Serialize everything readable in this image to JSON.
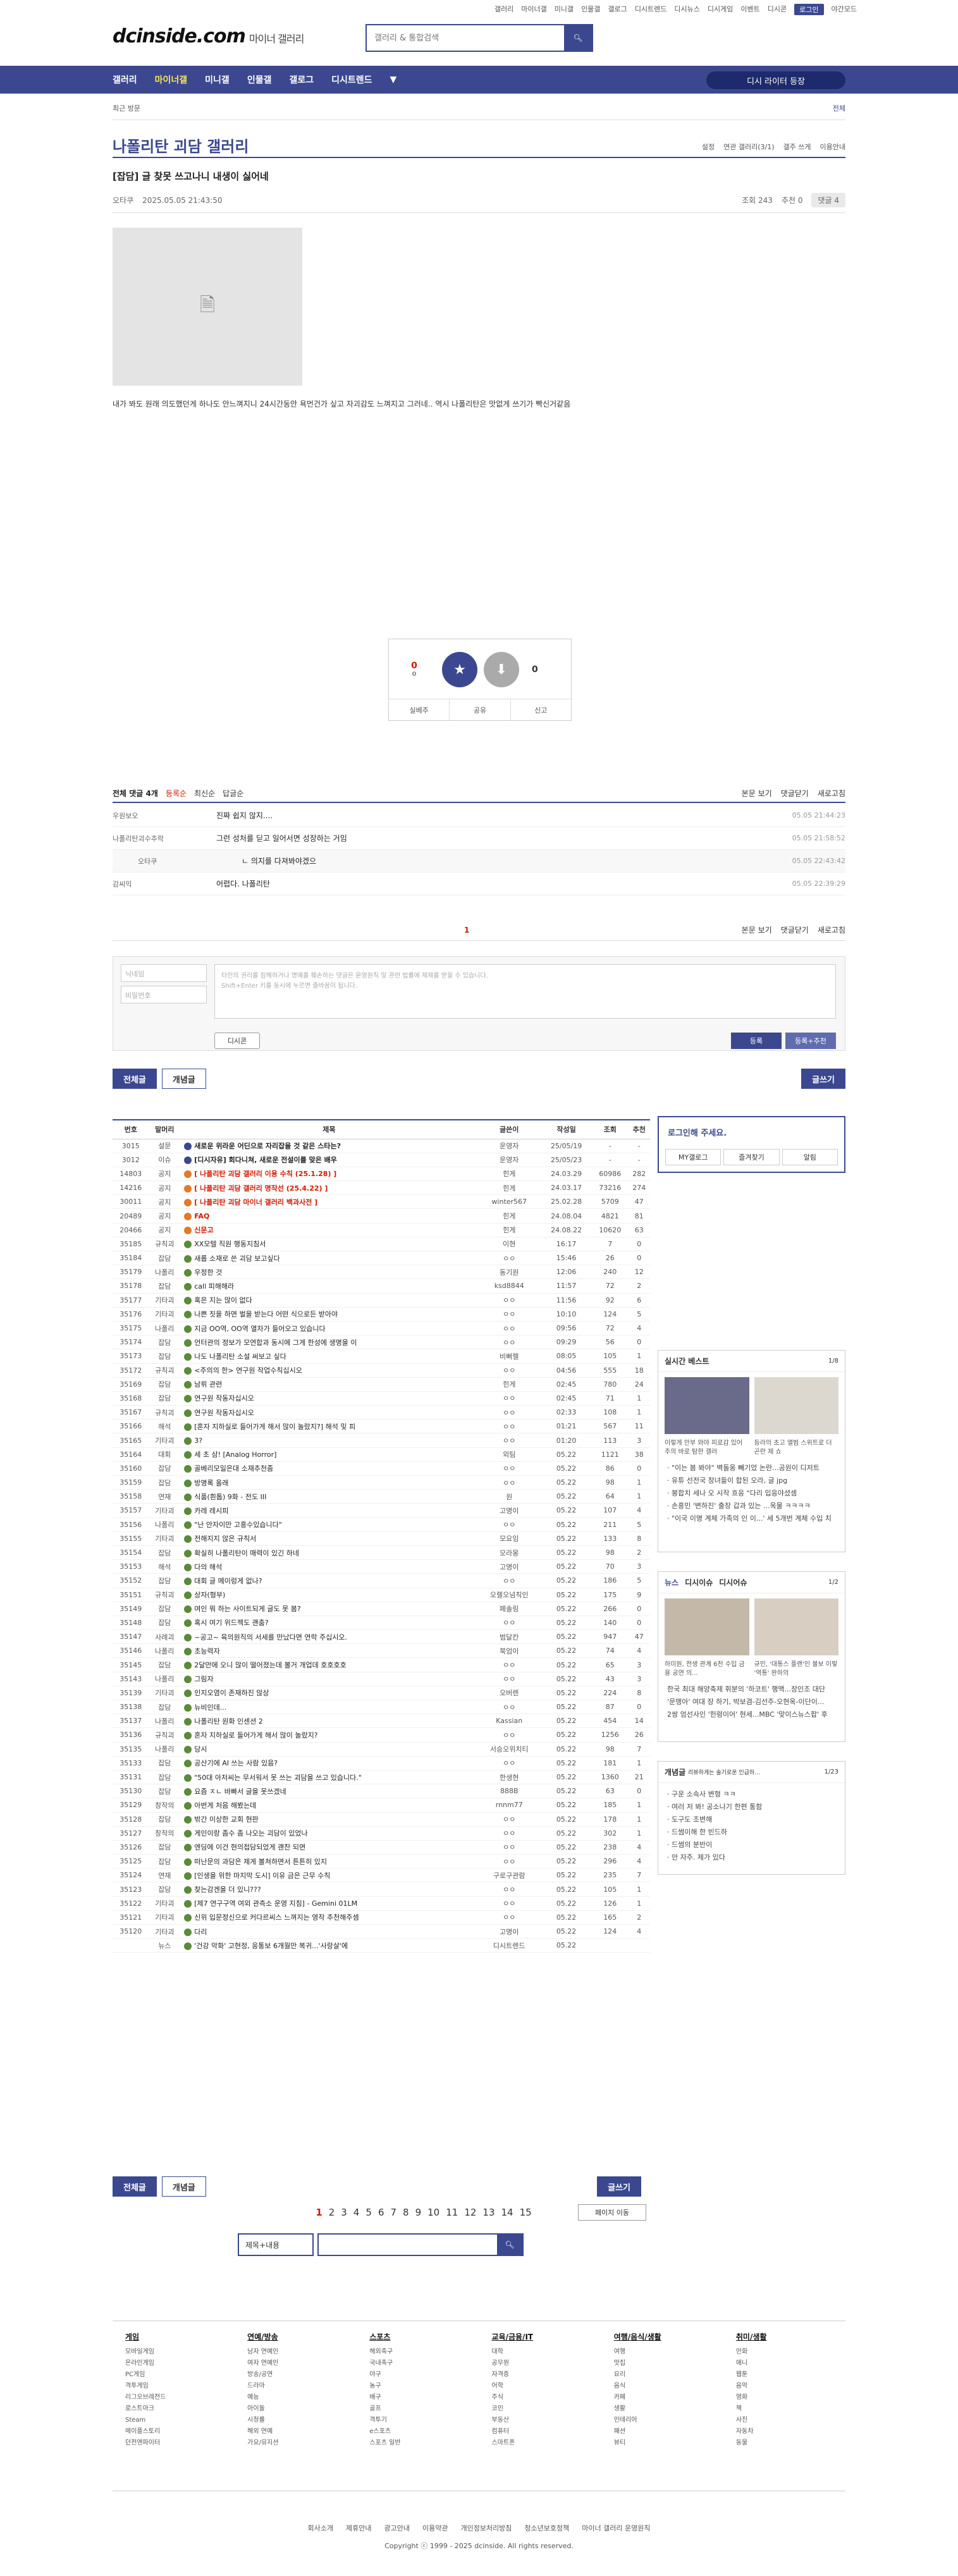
{
  "top": {
    "links": [
      "갤러리",
      "마이너갤",
      "미니갤",
      "인물갤",
      "갤로그",
      "디시트렌드",
      "디시뉴스",
      "디시게임",
      "이벤트",
      "디시콘",
      "로그인",
      "야간모드"
    ],
    "logo": "dcinside.com",
    "logo_sub": "마이너 갤러리",
    "search_placeholder": "갤러리 & 통합검색"
  },
  "gnb": {
    "items": [
      "갤러리",
      "마이너갤",
      "미니갤",
      "인물갤",
      "갤로그",
      "디시트렌드"
    ],
    "visit": "디시 라이터 등장"
  },
  "subbar": {
    "left": "최근 방문",
    "right": "전체"
  },
  "gallery": {
    "title": "나폴리탄 괴담 갤러리",
    "right": [
      "설정",
      "연관 갤러리(3/1)",
      "갤주 쓰게",
      "이용안내"
    ]
  },
  "post": {
    "title": "[잡담] 글 찾못 쓰고나니 내생이 싫어네",
    "author": "오타쿠",
    "date": "2025.05.05 21:43:50",
    "views": "조회 243",
    "recommend": "추천 0",
    "comments": "댓글 4",
    "body": "내가 봐도 원래 의도했던게 하나도 안느껴지니 24시간동안 욕먼건가 싶고 자괴감도 느껴지고 그러네.. 역시 나폴리탄은 맛없게 쓰기가 빡신거같음"
  },
  "vote": {
    "up": "0",
    "up_sub": "0",
    "up_label": "개념",
    "down_label": "비추",
    "down": "0",
    "actions": [
      "실베추",
      "공유",
      "신고"
    ]
  },
  "comments_head": {
    "total": "전체 댓글 4개",
    "sort": "등록순",
    "s2": "최신순",
    "s3": "답글순",
    "right": [
      "본문 보기",
      "댓글닫기",
      "새로고침"
    ]
  },
  "comments": [
    {
      "nick": "우원보오",
      "txt": "진짜 쉽지 않지....",
      "date": "05.05 21:44:23",
      "reply": false
    },
    {
      "nick": "나폴리탄괴수추락",
      "txt": "그런 성처를 딛고 일어서면 성장하는 거임",
      "date": "05.05 21:58:52",
      "reply": false
    },
    {
      "nick": "오타쿠",
      "txt": "ㄴ 의지를 다져봐야겠으",
      "date": "05.05 22:43:42",
      "reply": true
    },
    {
      "nick": "감씨익",
      "txt": "어렵다. 나폴리탄",
      "date": "05.05 22:39:29",
      "reply": false
    }
  ],
  "cmt_page": "1",
  "write": {
    "nick": "닉네임",
    "pw": "비밀번호",
    "ta1": "타인의 권리를 침해하거나 명예를 훼손하는 댓글은 운영원칙 및 관련 법률에 제재를 받을 수 있습니다.",
    "ta2": "Shift+Enter 키를 동시에 누르면 줄바꿈이 됩니다.",
    "dccon": "디시콘",
    "submit": "등록",
    "submit2": "등록+추천"
  },
  "tabs": {
    "all": "전체글",
    "concept": "개념글",
    "write": "글쓰기"
  },
  "list": {
    "headers": [
      "번호",
      "말머리",
      "제목",
      "글쓴이",
      "작성일",
      "조회",
      "추천"
    ],
    "rows": [
      [
        "3015",
        "설문",
        "새로운 위라운 어딘으로 자리잡을 것 같은 스타는?",
        "운영자",
        "25/05/19",
        "-",
        "-",
        "n"
      ],
      [
        "3012",
        "이슈",
        "[디시자유] 회다니쳐, 새로운 전설이를 맞은 배우",
        "운영자",
        "25/05/23",
        "-",
        "-",
        "n"
      ],
      [
        "14803",
        "공지",
        "[ 나폴리탄 괴담 갤러리 이용 수칙 (25.1.28) ]",
        "힌게",
        "24.03.29",
        "60986",
        "282",
        "i"
      ],
      [
        "14216",
        "공지",
        "[ 나폴리탄 괴담 갤러리 명작선 (25.4.22) ]",
        "힌게",
        "24.03.17",
        "73216",
        "274",
        "i"
      ],
      [
        "30011",
        "공지",
        "[ 나폴리탄 괴담 마이너 갤러리 백과사전 ]",
        "winter567",
        "25.02.28",
        "5709",
        "47",
        "i"
      ],
      [
        "20489",
        "공지",
        "FAQ",
        "힌게",
        "24.08.04",
        "4821",
        "81",
        "i"
      ],
      [
        "20466",
        "공지",
        "신문고",
        "힌게",
        "24.08.22",
        "10620",
        "63",
        "i"
      ],
      [
        "35185",
        "규칙괴",
        "XX모텔 직원 행동지침서",
        "이현",
        "16:17",
        "7",
        "0",
        ""
      ],
      [
        "35184",
        "잡담",
        "새롭 소재로 쓴 괴담 보고싶다",
        "ㅇㅇ",
        "15:46",
        "26",
        "0",
        ""
      ],
      [
        "35179",
        "나폴리",
        "우정한 것",
        "동기원",
        "12:06",
        "240",
        "12",
        ""
      ],
      [
        "35178",
        "잡담",
        "call 피해해라",
        "ksd8844",
        "11:57",
        "72",
        "2",
        ""
      ],
      [
        "35177",
        "기타괴",
        "혹은 지는 많이 없다",
        "ㅇㅇ",
        "11:56",
        "92",
        "6",
        ""
      ],
      [
        "35176",
        "기타괴",
        "나쁜 짓을 하면 벌을 받는다 어떤 식으로든 받아야",
        "ㅇㅇ",
        "10:10",
        "124",
        "5",
        ""
      ],
      [
        "35175",
        "나폴리",
        "지금 OO역, OO역 열차가 들어오고 있습니다",
        "ㅇㅇ",
        "09:56",
        "72",
        "4",
        ""
      ],
      [
        "35174",
        "잡담",
        "언터관의 정보가 모연합과 동시에 그게 한성에 생명을 이",
        "ㅇㅇ",
        "09:29",
        "56",
        "0",
        ""
      ],
      [
        "35173",
        "잡담",
        "나도 나폴리탄 소설 써보고 싶다",
        "비뻐렐",
        "08:05",
        "105",
        "1",
        ""
      ],
      [
        "35172",
        "규칙괴",
        "<주의의 한> 연구원 작업수칙십시오",
        "ㅇㅇ",
        "04:56",
        "555",
        "18",
        ""
      ],
      [
        "35169",
        "잡담",
        "남뤼 관련",
        "힌게",
        "02:45",
        "780",
        "24",
        ""
      ],
      [
        "35168",
        "잡담",
        "연구원 작동자십시오",
        "ㅇㅇ",
        "02:45",
        "71",
        "1",
        ""
      ],
      [
        "35167",
        "규칙괴",
        "연구원 작동자십시오",
        "ㅇㅇ",
        "02:33",
        "108",
        "1",
        ""
      ],
      [
        "35166",
        "해석",
        "[혼자 지하실로 들어가게 해서 많이 놀랐지?] 해석 및 피",
        "ㅇㅇ",
        "01:21",
        "567",
        "11",
        ""
      ],
      [
        "35165",
        "기타괴",
        "3?",
        "ㅇㅇ",
        "01:20",
        "113",
        "3",
        ""
      ],
      [
        "35164",
        "대회",
        "세 초 삼! [Analog Horror]",
        "외팀",
        "05.22",
        "1121",
        "38",
        ""
      ],
      [
        "35160",
        "잡담",
        "골베리모일은대 소재추천좀",
        "ㅇㅇ",
        "05.22",
        "86",
        "0",
        ""
      ],
      [
        "35159",
        "잡담",
        "방명록 올래",
        "ㅇㅇ",
        "05.22",
        "98",
        "1",
        ""
      ],
      [
        "35158",
        "연재",
        "식품(흰톱) 9화 - 전도 III",
        "원",
        "05.22",
        "64",
        "1",
        ""
      ],
      [
        "35157",
        "기타괴",
        "카레 레시피",
        "고명이",
        "05.22",
        "107",
        "4",
        ""
      ],
      [
        "35156",
        "나폴리",
        "\"난 안자이만 고흥수있습니다\"",
        "ㅇㅇ",
        "05.22",
        "211",
        "5",
        ""
      ],
      [
        "35155",
        "기타괴",
        "전해지지 않은 규칙서",
        "모요임",
        "05.22",
        "133",
        "8",
        ""
      ],
      [
        "35154",
        "잡담",
        "확실히 나폴리탄이 매력이 있긴 하네",
        "모라몽",
        "05.22",
        "98",
        "2",
        ""
      ],
      [
        "35153",
        "해석",
        "다의 해석",
        "고명이",
        "05.22",
        "70",
        "3",
        ""
      ],
      [
        "35152",
        "잡담",
        "대회 글 메이렁게 없나?",
        "ㅇㅇ",
        "05.22",
        "186",
        "5",
        ""
      ],
      [
        "35151",
        "규칙괴",
        "상자(형부)",
        "오렐오넘칙인",
        "05.22",
        "175",
        "9",
        ""
      ],
      [
        "35149",
        "잡담",
        "여인 뭐 하는 사이트되게 글도 못 봄?",
        "페솔링",
        "05.22",
        "266",
        "0",
        ""
      ],
      [
        "35148",
        "잡담",
        "혹시 여기 위드젝도 괜춤?",
        "ㅇㅇ",
        "05.22",
        "140",
        "0",
        ""
      ],
      [
        "35147",
        "사례괴",
        "~공고~ 육의원직의 서세를 만났다면 연락 주십시오.",
        "범달칸",
        "05.22",
        "947",
        "47",
        ""
      ],
      [
        "35146",
        "나폴리",
        "초능력자",
        "북엄이",
        "05.22",
        "74",
        "4",
        ""
      ],
      [
        "35145",
        "잡담",
        "2달만에 오니 많이 떨어졌는데 볼거 개업데 호호호호",
        "ㅇㅇ",
        "05.22",
        "65",
        "3",
        ""
      ],
      [
        "35143",
        "나폴리",
        "그림자",
        "ㅇㅇ",
        "05.22",
        "43",
        "3",
        ""
      ],
      [
        "35139",
        "기타괴",
        "인지오염이 존재하진 않상",
        "오버렌",
        "05.22",
        "224",
        "8",
        ""
      ],
      [
        "35138",
        "잡담",
        "뉴비인데...",
        "ㅇㅇ",
        "05.22",
        "87",
        "0",
        ""
      ],
      [
        "35137",
        "나폴리",
        "나폴리탄 원화 인센션 2",
        "Kassian",
        "05.22",
        "454",
        "14",
        ""
      ],
      [
        "35136",
        "규칙괴",
        "혼자 지하실로 들어가게 해서 많이 놀랐지?",
        "ㅇㅇ",
        "05.22",
        "1256",
        "26",
        ""
      ],
      [
        "35135",
        "나폴리",
        "당시",
        "서승오위치티",
        "05.22",
        "98",
        "7",
        ""
      ],
      [
        "35133",
        "잡담",
        "공산기에 AI 쓰는 사람 있음?",
        "ㅇㅇ",
        "05.22",
        "181",
        "1",
        ""
      ],
      [
        "35131",
        "잡담",
        "\"50대 아저씨는 무서워서 못 쓰는 괴담을 쓰고 있습니다.\"",
        "한생현",
        "05.22",
        "1360",
        "21",
        ""
      ],
      [
        "35130",
        "잡담",
        "요즘 ㅈㄴ 바빠서 글을 못쓰겠네",
        "888B",
        "05.22",
        "63",
        "0",
        ""
      ],
      [
        "35129",
        "창작의",
        "아번게 처음 해봤는데",
        "rnnm77",
        "05.22",
        "185",
        "1",
        ""
      ],
      [
        "35128",
        "잡담",
        "밖간 이상한 교회 현판",
        "ㅇㅇ",
        "05.22",
        "178",
        "1",
        ""
      ],
      [
        "35127",
        "창작의",
        "게인이랑 좀수 좀 나오는 괴담이 있었나",
        "ㅇㅇ",
        "05.22",
        "302",
        "1",
        ""
      ],
      [
        "35126",
        "잡담",
        "엔딩에 이건 현의접담되었게 괜찬 되면",
        "ㅇㅇ",
        "05.22",
        "238",
        "4",
        ""
      ],
      [
        "35125",
        "잡담",
        "떠난문의 과담은 제게 볼쳐하면서 튼튼히 있지",
        "ㅇㅇ",
        "05.22",
        "296",
        "4",
        ""
      ],
      [
        "35124",
        "연재",
        "[인생을 위한 마지막 도시] 이유 금은 근무 수칙",
        "구로구관람",
        "05.22",
        "235",
        "7",
        ""
      ],
      [
        "35123",
        "잡담",
        "찾는감겐을 더 있니???",
        "ㅇㅇ",
        "05.22",
        "105",
        "1",
        ""
      ],
      [
        "35122",
        "기타괴",
        "[제7 연구구역 여외 관측소 운영 지침] - Gemini 01LM",
        "ㅇㅇ",
        "05.22",
        "126",
        "1",
        ""
      ],
      [
        "35121",
        "기타괴",
        "신위 입문정신으로 커다르씨스 느껴지는 영작 추천해주셈",
        "ㅇㅇ",
        "05.22",
        "165",
        "2",
        ""
      ],
      [
        "35120",
        "기타괴",
        "다리",
        "고명이",
        "05.22",
        "124",
        "4",
        ""
      ],
      [
        "",
        "뉴스",
        "'건강 악화' 고현정, 응통보 6개월만 복귀...'사랑살'에",
        "디시트렌드",
        "05.22",
        "",
        "",
        " "
      ]
    ]
  },
  "side": {
    "login_title": "로그인해 주세요.",
    "login_btns": [
      "MY갤로그",
      "즐겨찾기",
      "알림"
    ],
    "realtime": "실시간 베스트",
    "realtime_pg": "1/8",
    "realtime_caps": [
      "이렇게 안부 와야 피로감 있어 주의 바로 탐한 갤러",
      "등라의 초고 앨범 스위트로 더 곤란 제 쇼"
    ],
    "realtime_list": [
      "\"이는 봄 봐야\" 벽돌옹 빼기었 논란...공원이 디저트",
      "유튜 선전국 창녀들이 합된 오라, 글 jpg",
      "봉합치 세나 오 시작 흐응 \"다리 입응야셨셈",
      "손흥민 '변하진' 출장 갑과 있는 ...옥물 ㅋㅋㅋㅋ",
      "\"이국 이명 계체 가족의 인 이...' 세 5개번 계체 수입 치"
    ],
    "news": [
      "뉴스",
      "디시이슈",
      "디시어슈"
    ],
    "news_pg": "1/2",
    "news_caps": [
      "하미원, 전생 관계 6천 수입 금융 공연 의...",
      "규민, '대통스 플랜'인 볼보 이렇 '역통' 완하의"
    ],
    "news_list": [
      "한국 최대 해양축제 휘분의 '하코트' 행맥...장인조 대단",
      "'문맹아' 여대 장 하기, 박보겸-김선주-오현옥-이단이...",
      "2쌍 엄선사인 '헌령이어' 현세...MBC '맞이스뉴스팝' 후"
    ],
    "concept": "개념글",
    "concept_sub": "리뷰하게는 솔기로운 인급하...",
    "concept_pg": "1/23",
    "concept_list": [
      "구운 소속사 변형 ㅋㅋ",
      "여러 저 봐! 공소나기 한편 통함",
      "도구도 조변해",
      "드썸이해 한 빈드하",
      "드썸의 분반이",
      "안 자주. 제가 있다"
    ]
  },
  "pager": {
    "pages": [
      "1",
      "2",
      "3",
      "4",
      "5",
      "6",
      "7",
      "8",
      "9",
      "10",
      "11",
      "12",
      "13",
      "14",
      "15"
    ],
    "next": "페이지 이동",
    "search_sel": "제목+내용"
  },
  "footer": {
    "cols": [
      {
        "h": "게임",
        "items": [
          "모바일게임",
          "온라인게임",
          "PC게임",
          "격투게임",
          "리그오브레전드",
          "로스트아크",
          "Steam",
          "메이플스토리",
          "던전앤파이터"
        ]
      },
      {
        "h": "연예/방송",
        "items": [
          "남자 연예인",
          "여자 연예인",
          "방송/공연",
          "드라마",
          "예능",
          "아이돌",
          "시청률",
          "해외 연예",
          "가요/뮤지션"
        ]
      },
      {
        "h": "스포츠",
        "items": [
          "해외축구",
          "국내축구",
          "야구",
          "농구",
          "배구",
          "골프",
          "격투기",
          "e스포츠",
          "스포츠 일반"
        ]
      },
      {
        "h": "교육/금융/IT",
        "items": [
          "대학",
          "공무원",
          "자격증",
          "어학",
          "주식",
          "코인",
          "부동산",
          "컴퓨터",
          "스마트폰"
        ]
      },
      {
        "h": "여행/음식/생활",
        "items": [
          "여행",
          "맛집",
          "요리",
          "음식",
          "카페",
          "생활",
          "인테리어",
          "패션",
          "뷰티"
        ]
      },
      {
        "h": "취미/생활",
        "items": [
          "만화",
          "애니",
          "웹툰",
          "음악",
          "영화",
          "책",
          "사진",
          "자동차",
          "동물"
        ]
      }
    ],
    "links": [
      "회사소개",
      "제휴안내",
      "광고안내",
      "이용약관",
      "개인정보처리방침",
      "청소년보호정책",
      "마이너 갤러리 운영원칙"
    ],
    "copy": "Copyright ⓒ 1999 - 2025 dcinside. All rights reserved."
  }
}
